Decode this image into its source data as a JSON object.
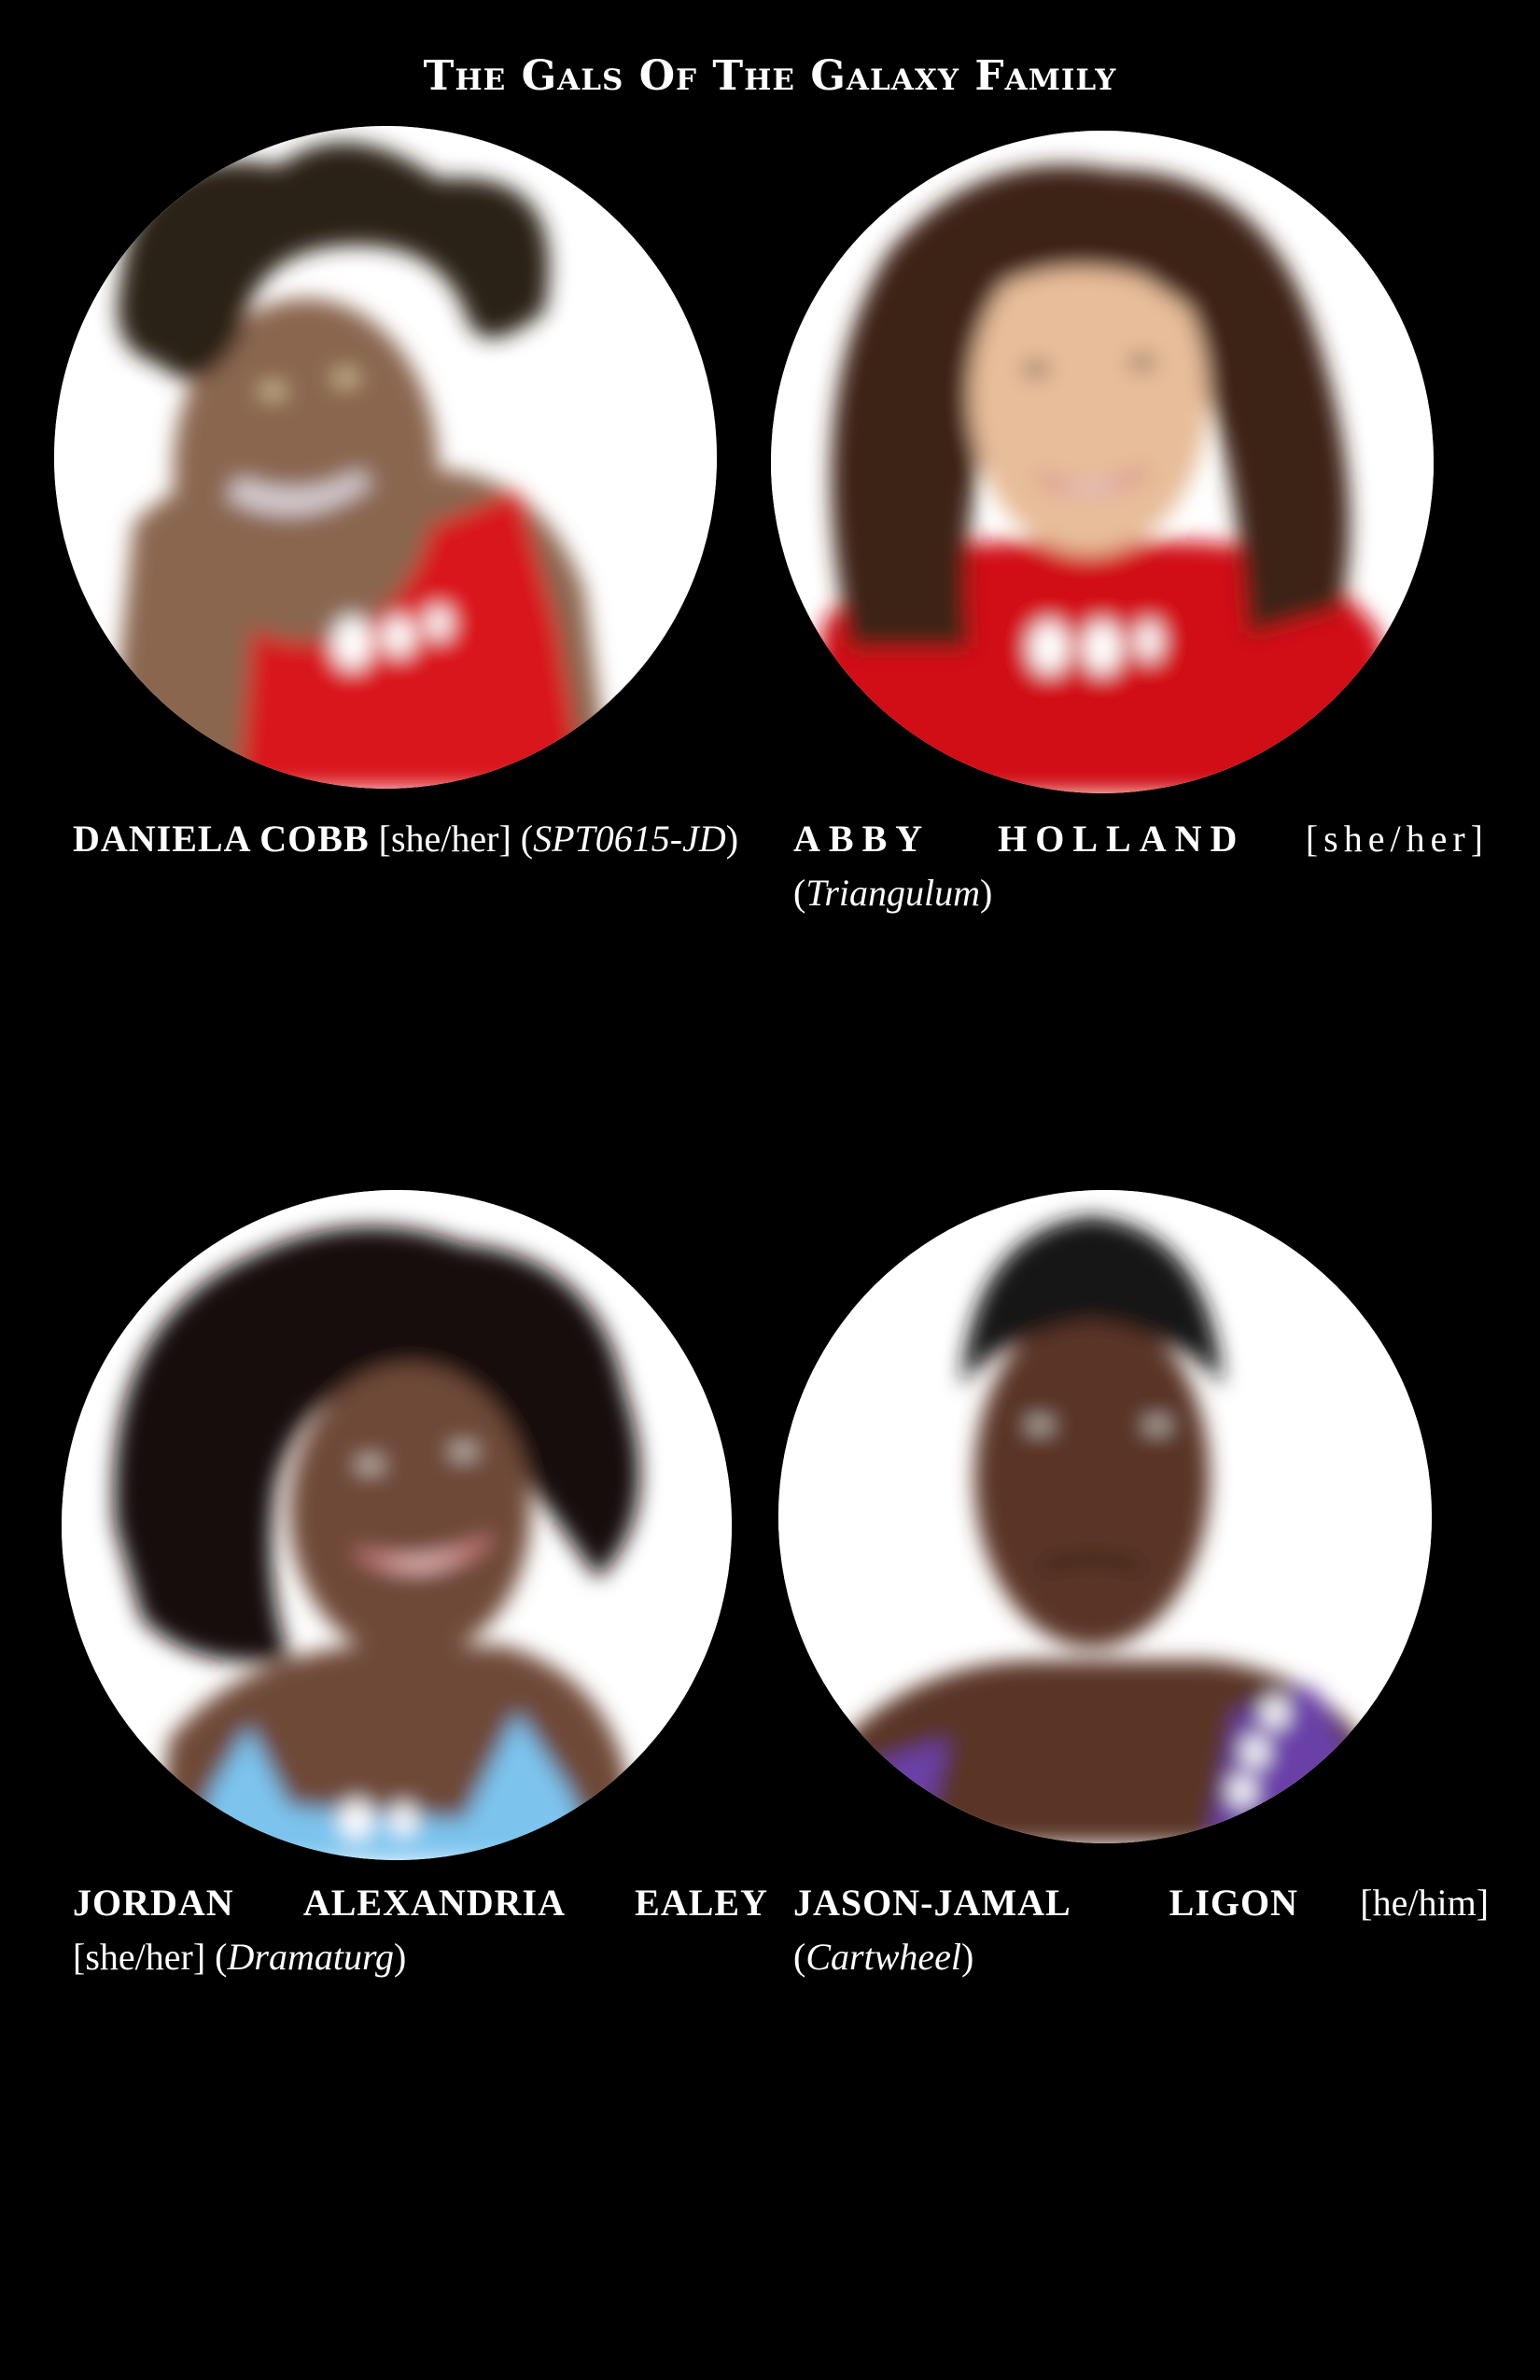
{
  "title": "The Gals Of The Galaxy Family",
  "members": [
    {
      "name": "DANIELA COBB",
      "pronouns": "[she/her]",
      "alias": "SPT0615-JD",
      "shirt_color": "#d9161c",
      "hair_color": "#2a2418",
      "skin_color": "#8a6650"
    },
    {
      "name": "ABBY HOLLAND",
      "pronouns": "[she/her]",
      "alias": "Triangulum",
      "shirt_color": "#d10f14",
      "hair_color": "#3c2218",
      "skin_color": "#e7bd9a"
    },
    {
      "name": "JORDAN ALEXANDRIA EALEY",
      "pronouns": "[she/her]",
      "alias": "Dramaturg",
      "shirt_color": "#7cc4ee",
      "hair_color": "#14110f",
      "skin_color": "#6e4a38"
    },
    {
      "name": "JASON-JAMAL LIGON",
      "pronouns": "[he/him]",
      "alias": "Cartwheel",
      "shirt_color": "#6a3fa8",
      "hair_color": "#151212",
      "skin_color": "#5a3426"
    }
  ]
}
